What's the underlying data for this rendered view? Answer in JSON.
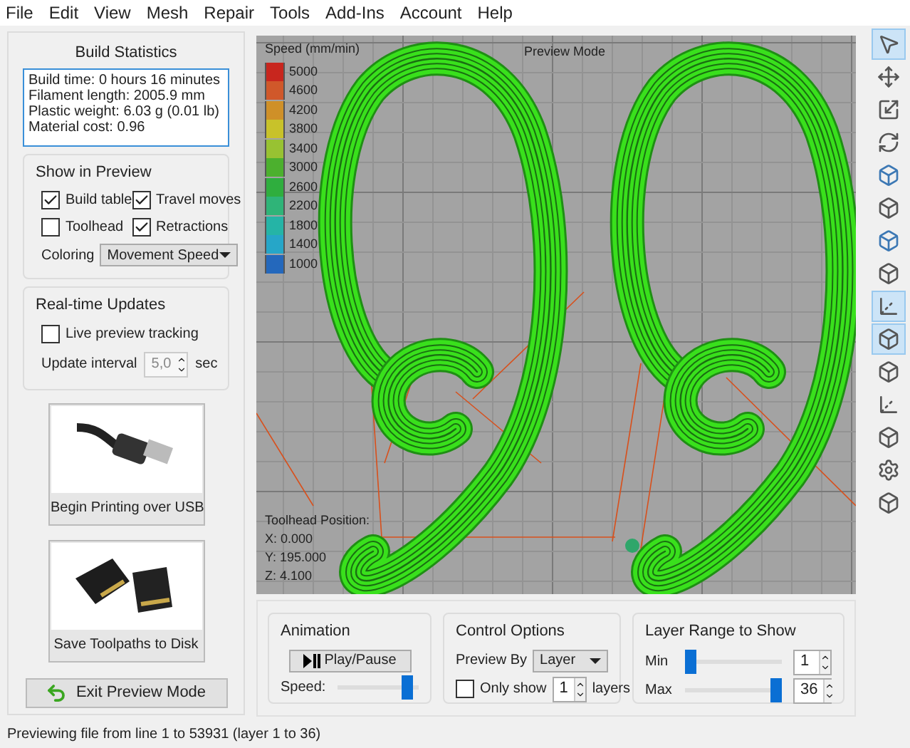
{
  "menu": [
    "File",
    "Edit",
    "View",
    "Mesh",
    "Repair",
    "Tools",
    "Add-Ins",
    "Account",
    "Help"
  ],
  "build_statistics": {
    "title": "Build Statistics",
    "lines": [
      "Build time: 0 hours 16 minutes",
      "Filament length: 2005.9 mm",
      "Plastic weight: 6.03 g (0.01 lb)",
      "Material cost: 0.96"
    ]
  },
  "show_in_preview": {
    "title": "Show in Preview",
    "options": [
      {
        "label": "Build table",
        "checked": true
      },
      {
        "label": "Travel moves",
        "checked": true
      },
      {
        "label": "Toolhead",
        "checked": false
      },
      {
        "label": "Retractions",
        "checked": true
      }
    ],
    "coloring_label": "Coloring",
    "coloring_value": "Movement Speed"
  },
  "realtime_updates": {
    "title": "Real-time Updates",
    "live_tracking": {
      "label": "Live preview tracking",
      "checked": false
    },
    "interval_label": "Update interval",
    "interval_value": "5,0",
    "interval_unit": "sec"
  },
  "action_buttons": [
    {
      "label": "Begin Printing over USB"
    },
    {
      "label": "Save Toolpaths to Disk"
    }
  ],
  "exit_button": "Exit Preview Mode",
  "viewport": {
    "mode_label": "Preview Mode",
    "legend_title": "Speed (mm/min)",
    "legend": [
      {
        "value": "5000",
        "color": "#c8261e"
      },
      {
        "value": "4600",
        "color": "#d0582a"
      },
      {
        "value": "4200",
        "color": "#cf9028"
      },
      {
        "value": "3800",
        "color": "#c8c22a"
      },
      {
        "value": "3400",
        "color": "#98c232"
      },
      {
        "value": "3000",
        "color": "#4cb02e"
      },
      {
        "value": "2600",
        "color": "#2fae3e"
      },
      {
        "value": "2200",
        "color": "#2fb478"
      },
      {
        "value": "1800",
        "color": "#25b4a6"
      },
      {
        "value": "1400",
        "color": "#26a6c8"
      },
      {
        "value": "1000",
        "color": "#2468bc"
      }
    ],
    "toolhead_title": "Toolhead Position:",
    "toolhead_lines": [
      "X: 0.000",
      "Y: 195.000",
      "Z: 4.100"
    ]
  },
  "animation": {
    "title": "Animation",
    "play_button": "Play/Pause",
    "speed_label": "Speed:",
    "speed": {
      "level": 0.92
    }
  },
  "control_options": {
    "title": "Control Options",
    "preview_by_label": "Preview By",
    "preview_by_value": "Layer",
    "only_show": {
      "label": "Only show",
      "checked": false
    },
    "only_show_value": "1",
    "only_show_unit": "layers"
  },
  "layer_range": {
    "title": "Layer Range to Show",
    "min_label": "Min",
    "min": {
      "level": 0
    },
    "min_value": "1",
    "max_label": "Max",
    "max": {
      "level": 1
    },
    "max_value": "36"
  },
  "toolbar": [
    {
      "selected": true
    },
    {
      "selected": false
    },
    {
      "selected": false
    },
    {
      "selected": false
    },
    {
      "selected": false
    },
    {
      "selected": false
    },
    {
      "selected": false
    },
    {
      "selected": false
    },
    {
      "selected": true
    },
    {
      "selected": true
    },
    {
      "selected": false
    },
    {
      "selected": false
    },
    {
      "selected": false
    },
    {
      "selected": false
    },
    {
      "selected": false
    }
  ],
  "status_bar": "Previewing file from line 1 to 53931 (layer 1 to 36)"
}
